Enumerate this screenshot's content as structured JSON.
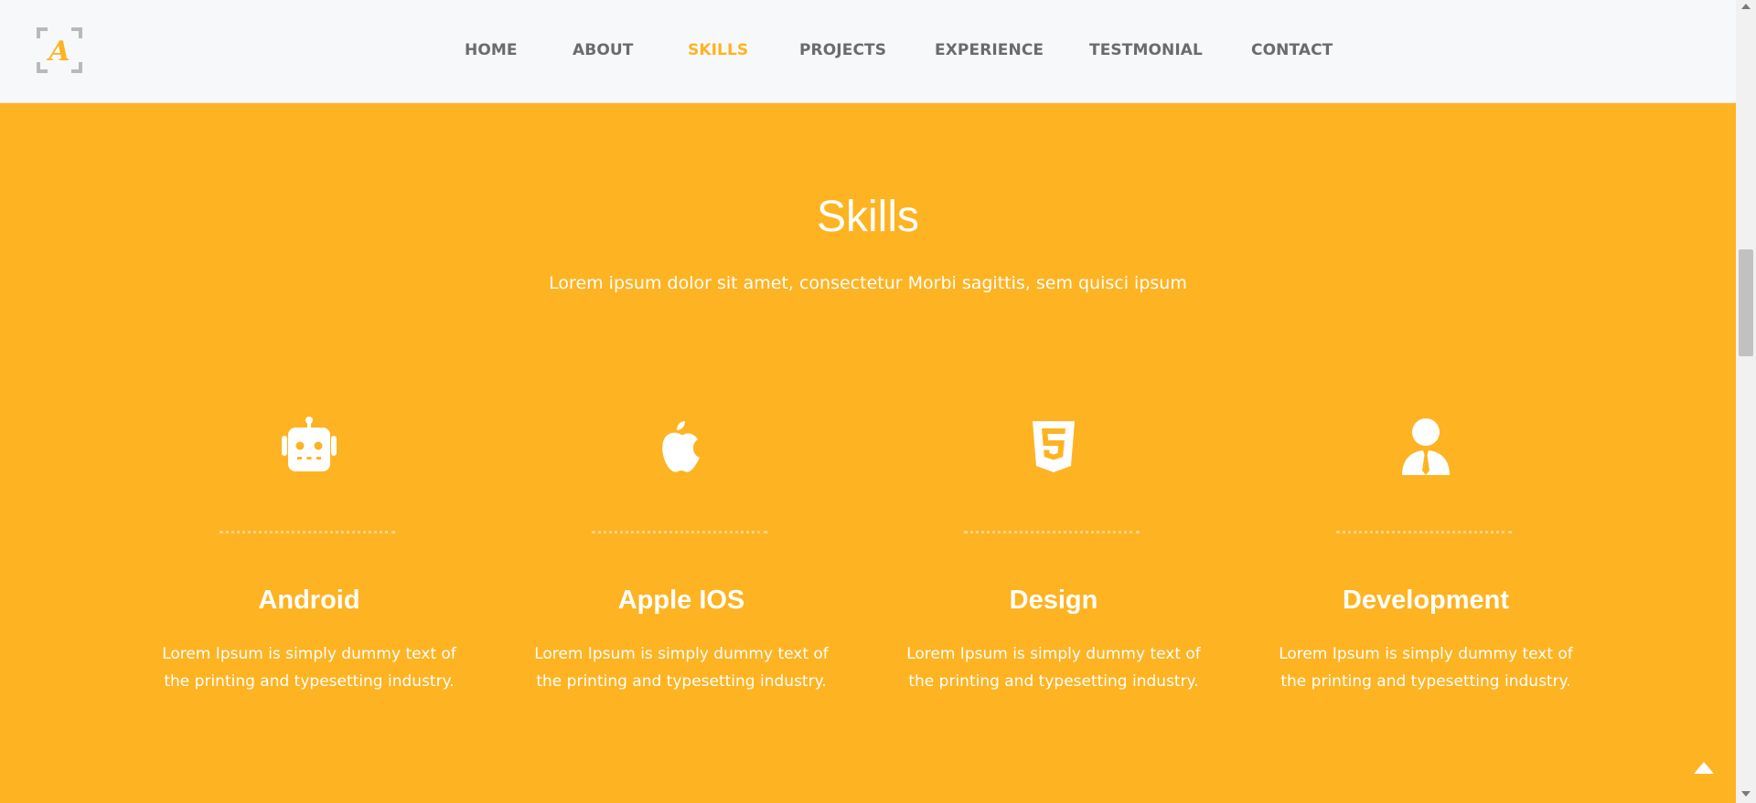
{
  "nav": {
    "items": [
      {
        "label": "HOME",
        "active": false
      },
      {
        "label": "ABOUT",
        "active": false
      },
      {
        "label": "SKILLS",
        "active": true
      },
      {
        "label": "PROJECTS",
        "active": false
      },
      {
        "label": "EXPERIENCE",
        "active": false
      },
      {
        "label": "TESTMONIAL",
        "active": false
      },
      {
        "label": "CONTACT",
        "active": false
      }
    ]
  },
  "logo": {
    "letter": "A"
  },
  "section": {
    "title": "Skills",
    "subtitle": "Lorem ipsum dolor sit amet, consectetur Morbi sagittis, sem quisci ipsum"
  },
  "skills": [
    {
      "icon": "robot-icon",
      "name": "Android",
      "description": "Lorem Ipsum is simply dummy text of the printing and typesetting industry."
    },
    {
      "icon": "apple-icon",
      "name": "Apple IOS",
      "description": "Lorem Ipsum is simply dummy text of the printing and typesetting industry."
    },
    {
      "icon": "html5-icon",
      "name": "Design",
      "description": "Lorem Ipsum is simply dummy text of the printing and typesetting industry."
    },
    {
      "icon": "user-tie-icon",
      "name": "Development",
      "description": "Lorem Ipsum is simply dummy text of the printing and typesetting industry."
    }
  ],
  "colors": {
    "accent": "#feb322",
    "nav_bg": "#f7f8f9",
    "nav_text": "#6b6b6b",
    "white": "#ffffff"
  }
}
